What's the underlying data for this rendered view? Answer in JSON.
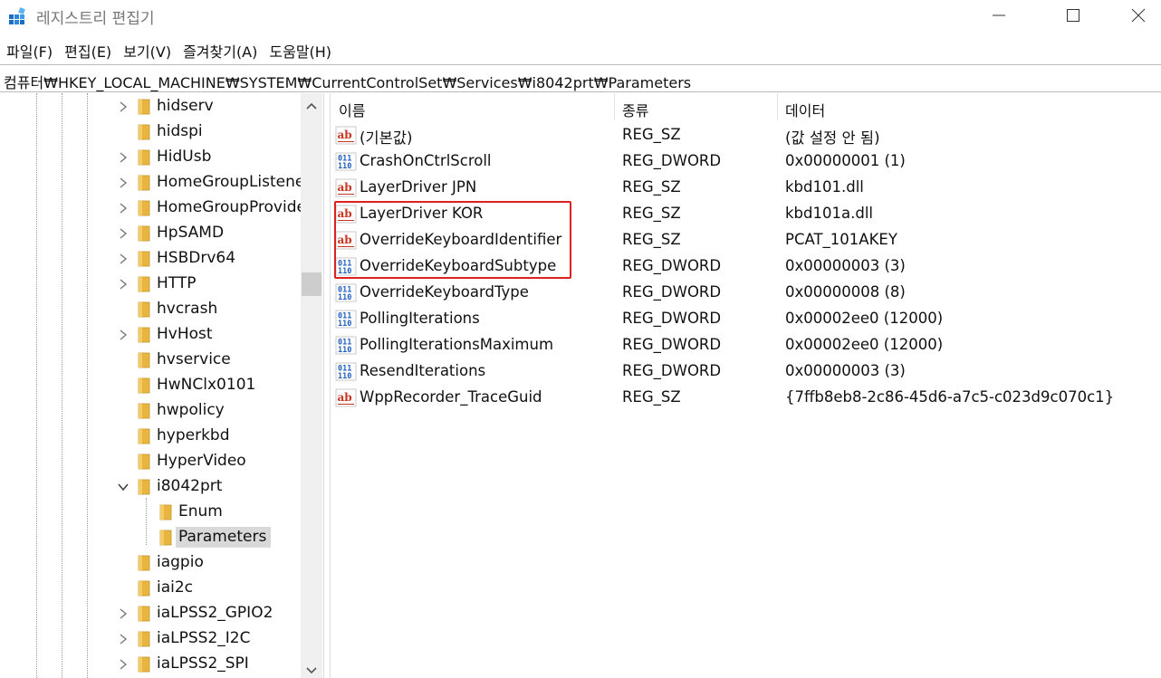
{
  "window": {
    "title": "레지스트리 편집기"
  },
  "menu": [
    {
      "label": "파일(F)"
    },
    {
      "label": "편집(E)"
    },
    {
      "label": "보기(V)"
    },
    {
      "label": "즐겨찾기(A)"
    },
    {
      "label": "도움말(H)"
    }
  ],
  "address": {
    "path": "컴퓨터₩HKEY_LOCAL_MACHINE₩SYSTEM₩CurrentControlSet₩Services₩i8042prt₩Parameters"
  },
  "tree": {
    "items": [
      {
        "label": "hidserv",
        "expander": "collapsed",
        "level": 0
      },
      {
        "label": "hidspi",
        "expander": "none",
        "level": 0
      },
      {
        "label": "HidUsb",
        "expander": "collapsed",
        "level": 0
      },
      {
        "label": "HomeGroupListene",
        "expander": "collapsed",
        "level": 0
      },
      {
        "label": "HomeGroupProvide",
        "expander": "collapsed",
        "level": 0
      },
      {
        "label": "HpSAMD",
        "expander": "collapsed",
        "level": 0
      },
      {
        "label": "HSBDrv64",
        "expander": "collapsed",
        "level": 0
      },
      {
        "label": "HTTP",
        "expander": "collapsed",
        "level": 0
      },
      {
        "label": "hvcrash",
        "expander": "none",
        "level": 0
      },
      {
        "label": "HvHost",
        "expander": "collapsed",
        "level": 0
      },
      {
        "label": "hvservice",
        "expander": "none",
        "level": 0
      },
      {
        "label": "HwNClx0101",
        "expander": "none",
        "level": 0
      },
      {
        "label": "hwpolicy",
        "expander": "none",
        "level": 0
      },
      {
        "label": "hyperkbd",
        "expander": "none",
        "level": 0
      },
      {
        "label": "HyperVideo",
        "expander": "none",
        "level": 0
      },
      {
        "label": "i8042prt",
        "expander": "expanded",
        "level": 0
      },
      {
        "label": "Enum",
        "expander": "none",
        "level": 1
      },
      {
        "label": "Parameters",
        "expander": "none",
        "level": 1,
        "selected": true
      },
      {
        "label": "iagpio",
        "expander": "none",
        "level": 0
      },
      {
        "label": "iai2c",
        "expander": "none",
        "level": 0
      },
      {
        "label": "iaLPSS2_GPIO2",
        "expander": "collapsed",
        "level": 0
      },
      {
        "label": "iaLPSS2_I2C",
        "expander": "collapsed",
        "level": 0
      },
      {
        "label": "iaLPSS2_SPI",
        "expander": "collapsed",
        "level": 0
      }
    ]
  },
  "columns": {
    "name": "이름",
    "type": "종류",
    "data": "데이터"
  },
  "values": [
    {
      "name": "(기본값)",
      "type": "REG_SZ",
      "data": "(값 설정 안 됨)",
      "icon": "string-value-icon"
    },
    {
      "name": "CrashOnCtrlScroll",
      "type": "REG_DWORD",
      "data": "0x00000001 (1)",
      "icon": "binary-value-icon"
    },
    {
      "name": "LayerDriver JPN",
      "type": "REG_SZ",
      "data": "kbd101.dll",
      "icon": "string-value-icon"
    },
    {
      "name": "LayerDriver KOR",
      "type": "REG_SZ",
      "data": "kbd101a.dll",
      "icon": "string-value-icon"
    },
    {
      "name": "OverrideKeyboardIdentifier",
      "type": "REG_SZ",
      "data": "PCAT_101AKEY",
      "icon": "string-value-icon"
    },
    {
      "name": "OverrideKeyboardSubtype",
      "type": "REG_DWORD",
      "data": "0x00000003 (3)",
      "icon": "binary-value-icon"
    },
    {
      "name": "OverrideKeyboardType",
      "type": "REG_DWORD",
      "data": "0x00000008 (8)",
      "icon": "binary-value-icon"
    },
    {
      "name": "PollingIterations",
      "type": "REG_DWORD",
      "data": "0x00002ee0 (12000)",
      "icon": "binary-value-icon"
    },
    {
      "name": "PollingIterationsMaximum",
      "type": "REG_DWORD",
      "data": "0x00002ee0 (12000)",
      "icon": "binary-value-icon"
    },
    {
      "name": "ResendIterations",
      "type": "REG_DWORD",
      "data": "0x00000003 (3)",
      "icon": "binary-value-icon"
    },
    {
      "name": "WppRecorder_TraceGuid",
      "type": "REG_SZ",
      "data": "{7ffb8eb8-2c86-45d6-a7c5-c023d9c070c1}",
      "icon": "string-value-icon"
    }
  ],
  "colors": {
    "highlight_box": "#e0201f",
    "folder": "#e8b640",
    "selected_row": "#d9d9d9"
  }
}
